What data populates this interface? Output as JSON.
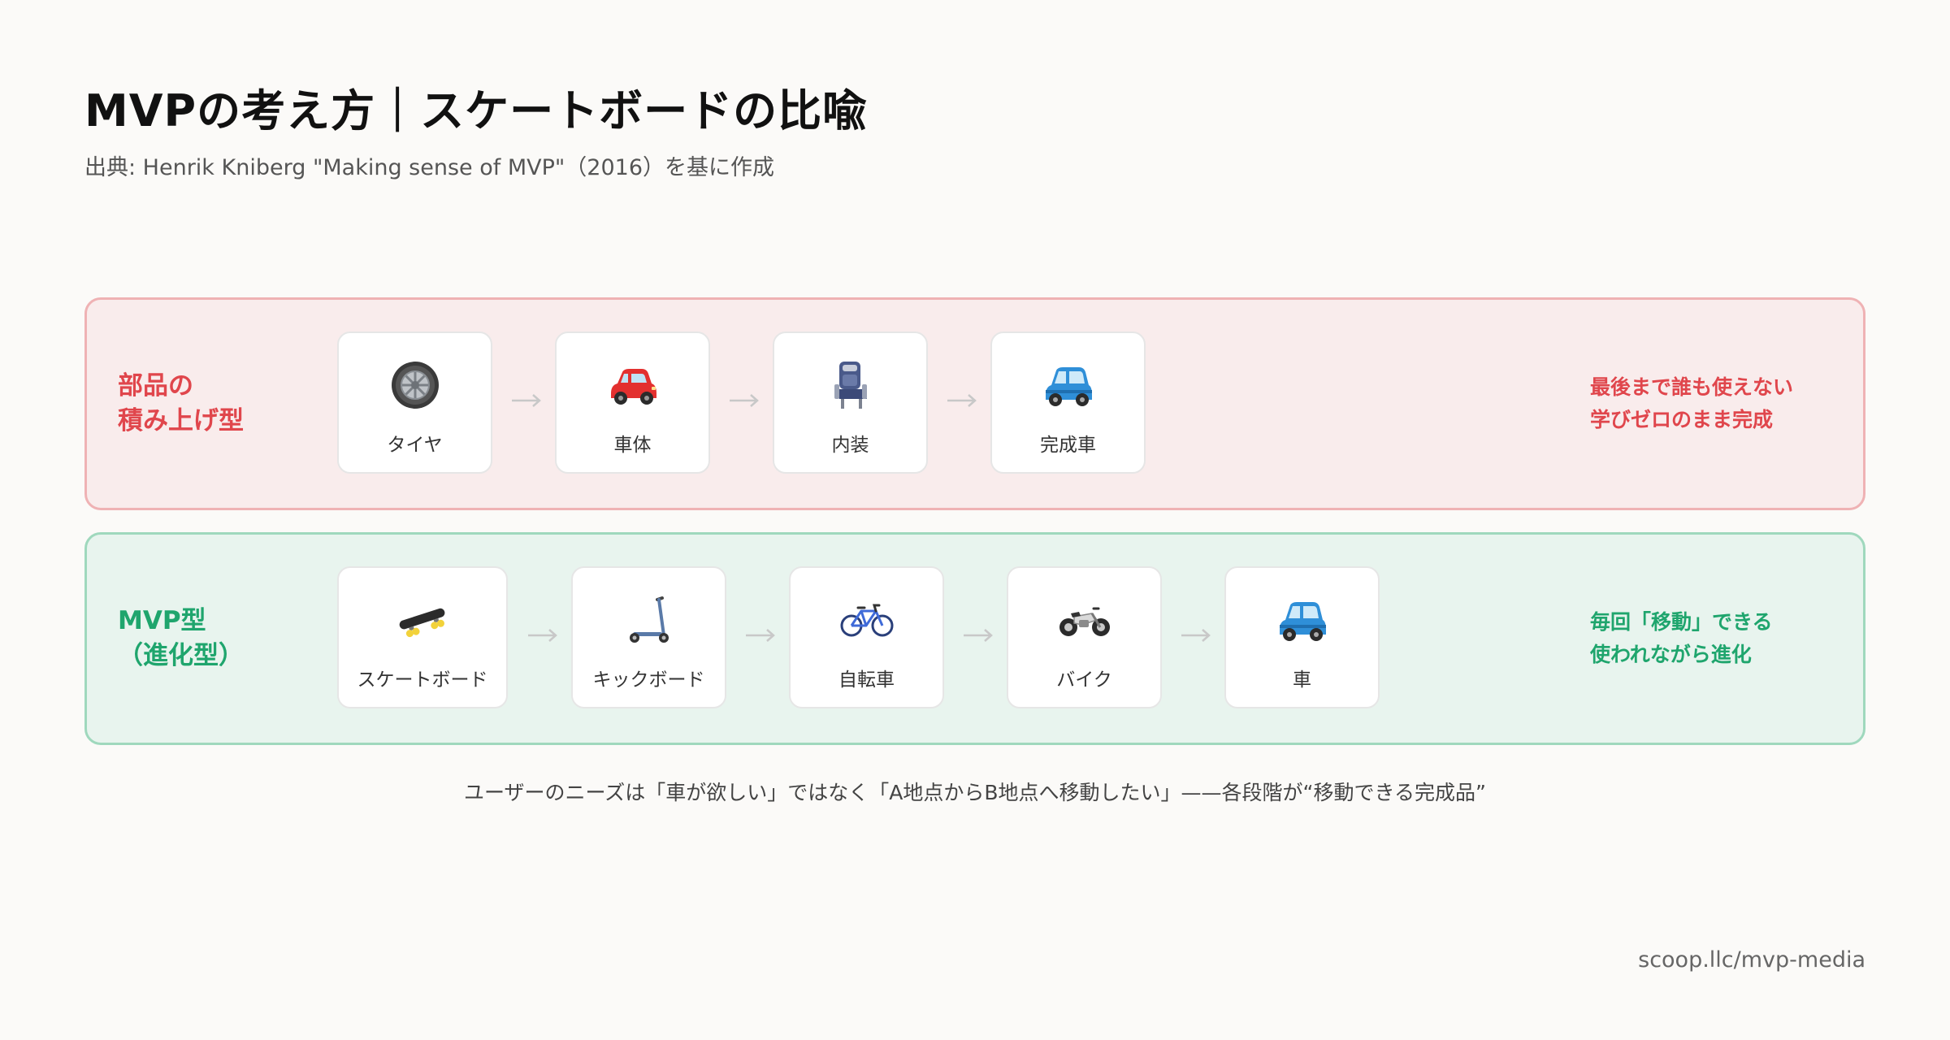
{
  "title": "MVPの考え方｜スケートボードの比喩",
  "subtitle": "出典: Henrik Kniberg \"Making sense of MVP\"（2016）を基に作成",
  "rows": [
    {
      "label_line1": "部品の",
      "label_line2": "積み上げ型",
      "color": "#e0464c",
      "items": [
        {
          "label": "タイヤ",
          "icon": "tire-icon"
        },
        {
          "label": "車体",
          "icon": "red-car-body-icon"
        },
        {
          "label": "内装",
          "icon": "seat-icon"
        },
        {
          "label": "完成車",
          "icon": "blue-car-icon"
        }
      ],
      "note_line1": "最後まで誰も使えない",
      "note_line2": "学びゼロのまま完成"
    },
    {
      "label_line1": "MVP型",
      "label_line2": "（進化型）",
      "color": "#1fa56d",
      "items": [
        {
          "label": "スケートボード",
          "icon": "skateboard-icon"
        },
        {
          "label": "キックボード",
          "icon": "kick-scooter-icon"
        },
        {
          "label": "自転車",
          "icon": "bicycle-icon"
        },
        {
          "label": "バイク",
          "icon": "motorcycle-icon"
        },
        {
          "label": "車",
          "icon": "blue-car-icon"
        }
      ],
      "note_line1": "毎回「移動」できる",
      "note_line2": "使われながら進化"
    }
  ],
  "footnote": "ユーザーのニーズは「車が欲しい」ではなく「A地点からB地点へ移動したい」——各段階が“移動できる完成品”",
  "credit": "scoop.llc/mvp-media"
}
